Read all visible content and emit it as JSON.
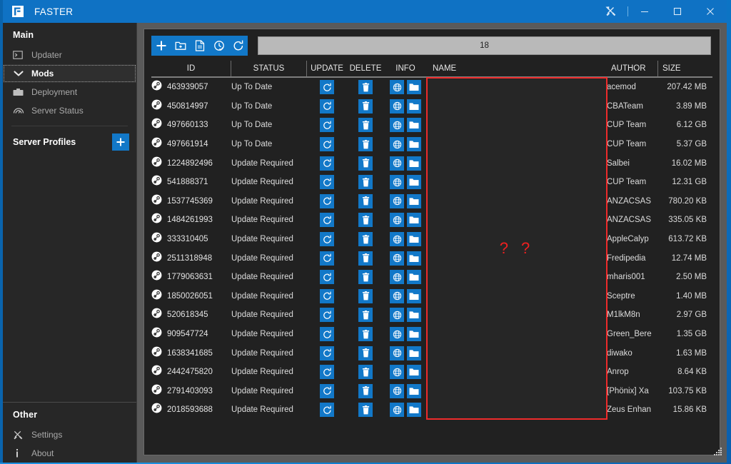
{
  "window": {
    "title": "FASTER",
    "logo_icon": "faster-logo-icon",
    "controls": [
      {
        "name": "tools-icon",
        "glyph": "tools"
      },
      {
        "name": "minimize-button",
        "glyph": "minimize"
      },
      {
        "name": "maximize-button",
        "glyph": "maximize"
      },
      {
        "name": "close-button",
        "glyph": "close"
      }
    ],
    "accent": "#0f72c4"
  },
  "sidebar": {
    "main_header": "Main",
    "items": [
      {
        "label": "Updater",
        "icon": "console-icon",
        "active": false
      },
      {
        "label": "Mods",
        "icon": "chevron-down-icon",
        "active": true
      },
      {
        "label": "Deployment",
        "icon": "briefcase-icon",
        "active": false
      },
      {
        "label": "Server Status",
        "icon": "gauge-icon",
        "active": false
      }
    ],
    "profiles_header": "Server Profiles",
    "add_profile_icon": "plus-icon",
    "other_header": "Other",
    "other_items": [
      {
        "label": "Settings",
        "icon": "tools-icon"
      },
      {
        "label": "About",
        "icon": "info-icon"
      }
    ]
  },
  "toolbar": {
    "buttons": [
      {
        "name": "add-mod-button",
        "icon": "plus-icon"
      },
      {
        "name": "add-local-mod-button",
        "icon": "folder-add-icon"
      },
      {
        "name": "import-preset-button",
        "icon": "file-icon"
      },
      {
        "name": "check-updates-button",
        "icon": "clock-check-icon"
      },
      {
        "name": "update-all-button",
        "icon": "refresh-icon"
      }
    ],
    "search_value": "18",
    "search_placeholder": ""
  },
  "table": {
    "columns": [
      "ID",
      "STATUS",
      "UPDATE",
      "DELETE",
      "INFO",
      "NAME",
      "AUTHOR",
      "SIZE"
    ],
    "row_icon": "steam-icon",
    "update_icon": "refresh-icon",
    "delete_icon": "trash-icon",
    "info_icon": "globe-icon",
    "folder_icon": "folder-icon",
    "rows": [
      {
        "id": "463939057",
        "status": "Up To Date",
        "name": "",
        "author": "acemod",
        "size": "207.42 MB"
      },
      {
        "id": "450814997",
        "status": "Up To Date",
        "name": "",
        "author": "CBATeam",
        "size": "3.89 MB"
      },
      {
        "id": "497660133",
        "status": "Up To Date",
        "name": "",
        "author": "CUP Team",
        "size": "6.12 GB"
      },
      {
        "id": "497661914",
        "status": "Up To Date",
        "name": "",
        "author": "CUP Team",
        "size": "5.37 GB"
      },
      {
        "id": "1224892496",
        "status": "Update Required",
        "name": "",
        "author": "Salbei",
        "size": "16.02 MB"
      },
      {
        "id": "541888371",
        "status": "Update Required",
        "name": "",
        "author": "CUP Team",
        "size": "12.31 GB"
      },
      {
        "id": "1537745369",
        "status": "Update Required",
        "name": "",
        "author": "ANZACSAS",
        "size": "780.20 KB"
      },
      {
        "id": "1484261993",
        "status": "Update Required",
        "name": "",
        "author": "ANZACSAS",
        "size": "335.05 KB"
      },
      {
        "id": "333310405",
        "status": "Update Required",
        "name": "",
        "author": "AppleCalyp",
        "size": "613.72 KB"
      },
      {
        "id": "2511318948",
        "status": "Update Required",
        "name": "",
        "author": "Fredipedia",
        "size": "12.74 MB"
      },
      {
        "id": "1779063631",
        "status": "Update Required",
        "name": "",
        "author": "mharis001",
        "size": "2.50 MB"
      },
      {
        "id": "1850026051",
        "status": "Update Required",
        "name": "",
        "author": "Sceptre",
        "size": "1.40 MB"
      },
      {
        "id": "520618345",
        "status": "Update Required",
        "name": "",
        "author": "M1lkM8n",
        "size": "2.97 GB"
      },
      {
        "id": "909547724",
        "status": "Update Required",
        "name": "",
        "author": "Green_Bere",
        "size": "1.35 GB"
      },
      {
        "id": "1638341685",
        "status": "Update Required",
        "name": "",
        "author": "diwako",
        "size": "1.63 MB"
      },
      {
        "id": "2442475820",
        "status": "Update Required",
        "name": "",
        "author": "Anrop",
        "size": "8.64 KB"
      },
      {
        "id": "2791403093",
        "status": "Update Required",
        "name": "",
        "author": "[Phönix] Xa",
        "size": "103.75 KB"
      },
      {
        "id": "2018593688",
        "status": "Update Required",
        "name": "",
        "author": "Zeus Enhan",
        "size": "15.86 KB"
      }
    ]
  },
  "annotation": {
    "name_column_marker": "? ?",
    "marker_color": "#ee2020",
    "box_border_color": "#ee2b2b"
  }
}
